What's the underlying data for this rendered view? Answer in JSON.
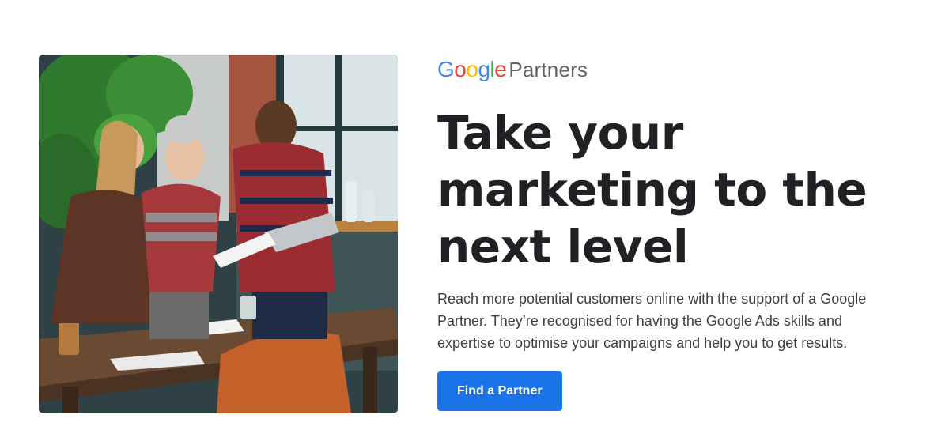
{
  "brand": {
    "logo_letters": [
      {
        "char": "G",
        "color": "#4285F4"
      },
      {
        "char": "o",
        "color": "#EA4335"
      },
      {
        "char": "o",
        "color": "#FBBC05"
      },
      {
        "char": "g",
        "color": "#4285F4"
      },
      {
        "char": "l",
        "color": "#34A853"
      },
      {
        "char": "e",
        "color": "#EA4335"
      }
    ],
    "product": "Partners"
  },
  "headline": {
    "line1": "Take your",
    "line2": "marketing to the",
    "line3": "next level"
  },
  "description": "Reach more potential customers online with the support of a Google Partner. They’re recognised for having the Google Ads skills and expertise to optimise your campaigns and help you to get results.",
  "cta": {
    "label": "Find a Partner",
    "color": "#1a73e8"
  },
  "image": {
    "icon": "team-collaboration-photo"
  }
}
